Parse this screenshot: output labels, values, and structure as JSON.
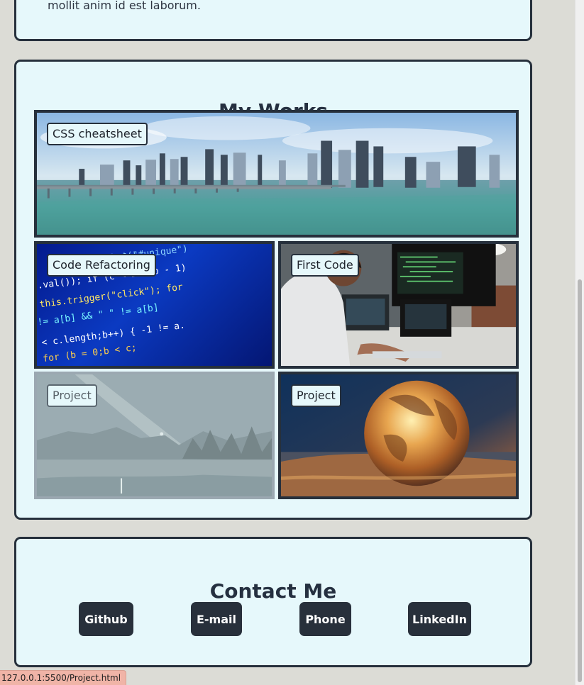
{
  "top_card": {
    "text": "mollit anim id est laborum."
  },
  "works": {
    "title": "My Works",
    "items": [
      {
        "label": "CSS cheatsheet"
      },
      {
        "label": "Code Refactoring"
      },
      {
        "label": "First Code"
      },
      {
        "label": "Project"
      },
      {
        "label": "Project"
      }
    ]
  },
  "contact": {
    "title": "Contact Me",
    "buttons": [
      "Github",
      "E-mail",
      "Phone",
      "LinkedIn"
    ]
  },
  "status_bar": {
    "url": "127.0.0.1:5500/Project.html"
  },
  "colors": {
    "card_bg": "#e6f8fb",
    "border": "#26303c",
    "button_bg": "#28303b",
    "page_bg": "#dcdcd6"
  }
}
